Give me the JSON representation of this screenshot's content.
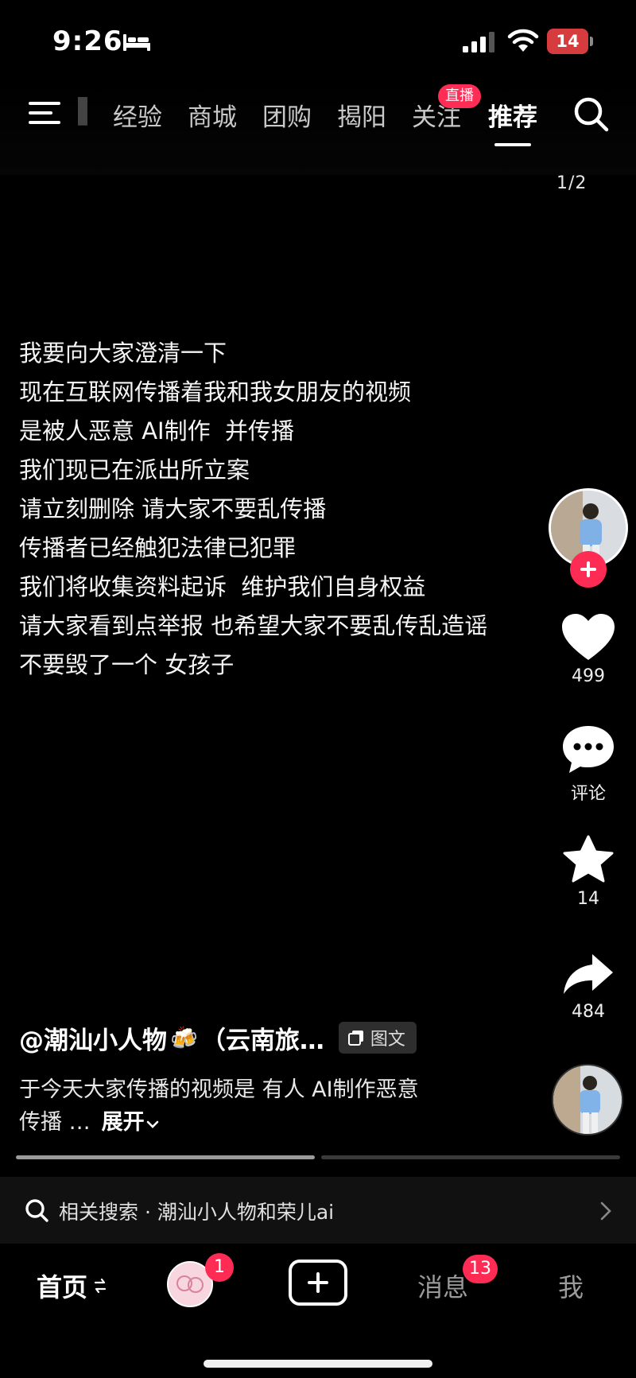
{
  "status_bar": {
    "time": "9:26",
    "battery": "14"
  },
  "top_nav": {
    "tabs": [
      "经验",
      "商城",
      "团购",
      "揭阳",
      "关注",
      "推荐"
    ],
    "active_tab": "推荐",
    "live_badge": "直播",
    "page_counter": "1/2"
  },
  "content_lines": [
    "我要向大家澄清一下",
    "现在互联网传播着我和我女朋友的视频",
    "是被人恶意 AI制作  并传播",
    "我们现已在派出所立案",
    "请立刻删除 请大家不要乱传播",
    "传播者已经触犯法律已犯罪",
    "我们将收集资料起诉  维护我们自身权益",
    "请大家看到点举报 也希望大家不要乱传乱造谣",
    "不要毁了一个 女孩子"
  ],
  "actions": {
    "likes": "499",
    "comments_label": "评论",
    "favorites": "14",
    "shares": "484"
  },
  "caption": {
    "author": "@潮汕小人物",
    "author_tail": "（云南旅…",
    "type_chip": "图文",
    "line1": "于今天大家传播的视频是 有人 AI制作恶意",
    "line2": "传播 …",
    "expand": "展开"
  },
  "related_search": {
    "label": "相关搜索 · 潮汕小人物和荣儿ai"
  },
  "tab_bar": {
    "home": "首页",
    "friend_badge": "1",
    "messages": "消息",
    "messages_badge": "13",
    "me": "我"
  },
  "colors": {
    "accent": "#fe2c55",
    "background": "#000000"
  },
  "icons": [
    "bed-icon",
    "signal-icon",
    "wifi-icon",
    "menu-icon",
    "search-icon",
    "heart-icon",
    "comment-icon",
    "star-icon",
    "share-icon",
    "gallery-icon",
    "chevron-down-icon",
    "chevron-right-icon",
    "swap-icon",
    "plus-icon"
  ]
}
